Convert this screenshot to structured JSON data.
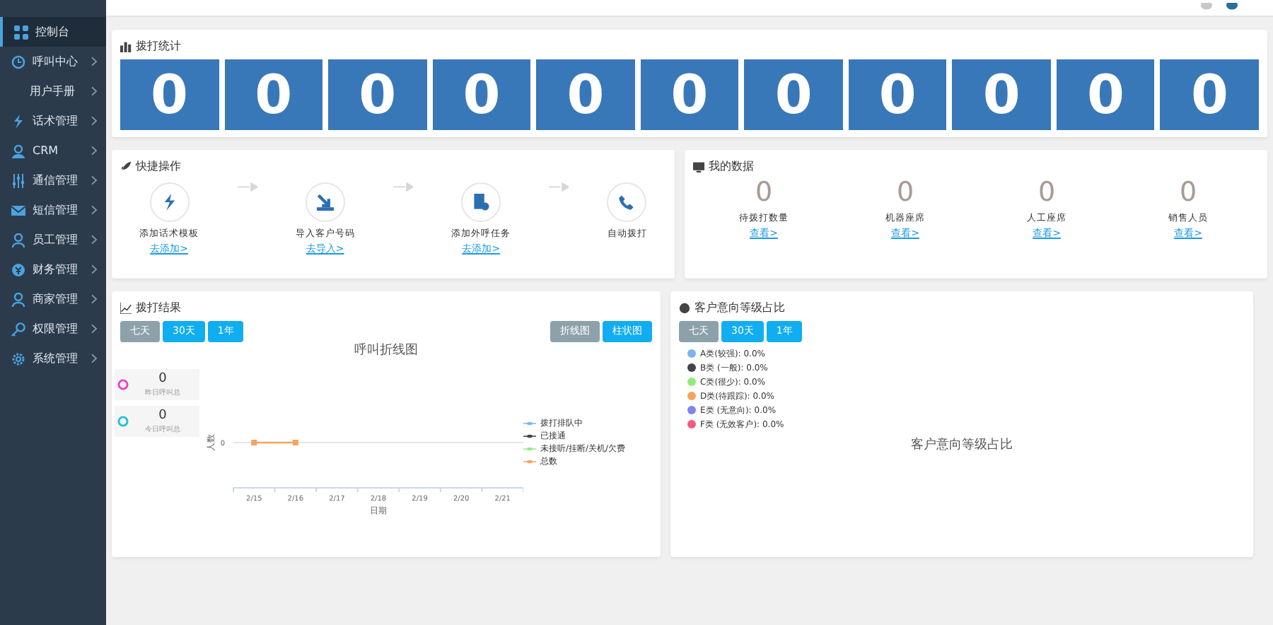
{
  "sidebar": {
    "items": [
      {
        "label": "控制台",
        "selected": true,
        "chevron": false,
        "sub": false
      },
      {
        "label": "呼叫中心",
        "selected": false,
        "chevron": true,
        "sub": false
      },
      {
        "label": "用户手册",
        "selected": false,
        "chevron": true,
        "sub": true
      },
      {
        "label": "话术管理",
        "selected": false,
        "chevron": true,
        "sub": false
      },
      {
        "label": "CRM",
        "selected": false,
        "chevron": true,
        "sub": false
      },
      {
        "label": "通信管理",
        "selected": false,
        "chevron": true,
        "sub": false
      },
      {
        "label": "短信管理",
        "selected": false,
        "chevron": true,
        "sub": false
      },
      {
        "label": "员工管理",
        "selected": false,
        "chevron": true,
        "sub": false
      },
      {
        "label": "财务管理",
        "selected": false,
        "chevron": true,
        "sub": false
      },
      {
        "label": "商家管理",
        "selected": false,
        "chevron": true,
        "sub": false
      },
      {
        "label": "权限管理",
        "selected": false,
        "chevron": true,
        "sub": false
      },
      {
        "label": "系统管理",
        "selected": false,
        "chevron": true,
        "sub": false
      }
    ]
  },
  "call_stats": {
    "title": "拨打统计",
    "counters": [
      "0",
      "0",
      "0",
      "0",
      "0",
      "0",
      "0",
      "0",
      "0",
      "0",
      "0"
    ]
  },
  "quick_actions": {
    "title": "快捷操作",
    "steps": [
      {
        "label": "添加话术模板",
        "link": "去添加>"
      },
      {
        "label": "导入客户号码",
        "link": "去导入>"
      },
      {
        "label": "添加外呼任务",
        "link": "去添加>"
      },
      {
        "label": "自动拨打"
      }
    ]
  },
  "my_data": {
    "title": "我的数据",
    "items": [
      {
        "value": "0",
        "label": "待拨打数量",
        "link": "查看>"
      },
      {
        "value": "0",
        "label": "机器座席",
        "link": "查看>"
      },
      {
        "value": "0",
        "label": "人工座席",
        "link": "查看>"
      },
      {
        "value": "0",
        "label": "销售人员",
        "link": "查看>"
      }
    ]
  },
  "call_results": {
    "title": "拨打结果",
    "ranges": [
      {
        "label": "七天",
        "selected": true
      },
      {
        "label": "30天",
        "selected": false
      },
      {
        "label": "1年",
        "selected": false
      }
    ],
    "chart_types": [
      {
        "label": "折线图",
        "selected": true
      },
      {
        "label": "柱状图",
        "selected": false
      }
    ],
    "summary": [
      {
        "value": "0",
        "label": "昨日呼叫总",
        "color": "#e83fd0"
      },
      {
        "value": "0",
        "label": "今日呼叫总",
        "color": "#1fc0dc"
      }
    ],
    "chart": {
      "title": "呼叫折线图",
      "xlabel": "日期",
      "ylabel": "人数",
      "y_tick": "0",
      "categories": [
        "2/15",
        "2/16",
        "2/17",
        "2/18",
        "2/19",
        "2/20",
        "2/21"
      ],
      "series": [
        {
          "name": "拨打排队中",
          "color": "#7cb5ec"
        },
        {
          "name": "已接通",
          "color": "#434348"
        },
        {
          "name": "未接听/挂断/关机/欠费",
          "color": "#90ed7d"
        },
        {
          "name": "总数",
          "color": "#f7a35c"
        }
      ]
    }
  },
  "intent_levels": {
    "title": "客户意向等级占比",
    "ranges": [
      {
        "label": "七天",
        "selected": true
      },
      {
        "label": "30天",
        "selected": false
      },
      {
        "label": "1年",
        "selected": false
      }
    ],
    "legend": [
      {
        "label": "A类(较强): 0.0%",
        "color": "#7cb5ec"
      },
      {
        "label": "B类 (一般): 0.0%",
        "color": "#434348"
      },
      {
        "label": "C类(很少): 0.0%",
        "color": "#90ed7d"
      },
      {
        "label": "D类(待跟踪): 0.0%",
        "color": "#f7a35c"
      },
      {
        "label": "E类 (无意向): 0.0%",
        "color": "#8085e9"
      },
      {
        "label": "F类 (无效客户): 0.0%",
        "color": "#f15c80"
      }
    ],
    "chart_title": "客户意向等级占比"
  }
}
